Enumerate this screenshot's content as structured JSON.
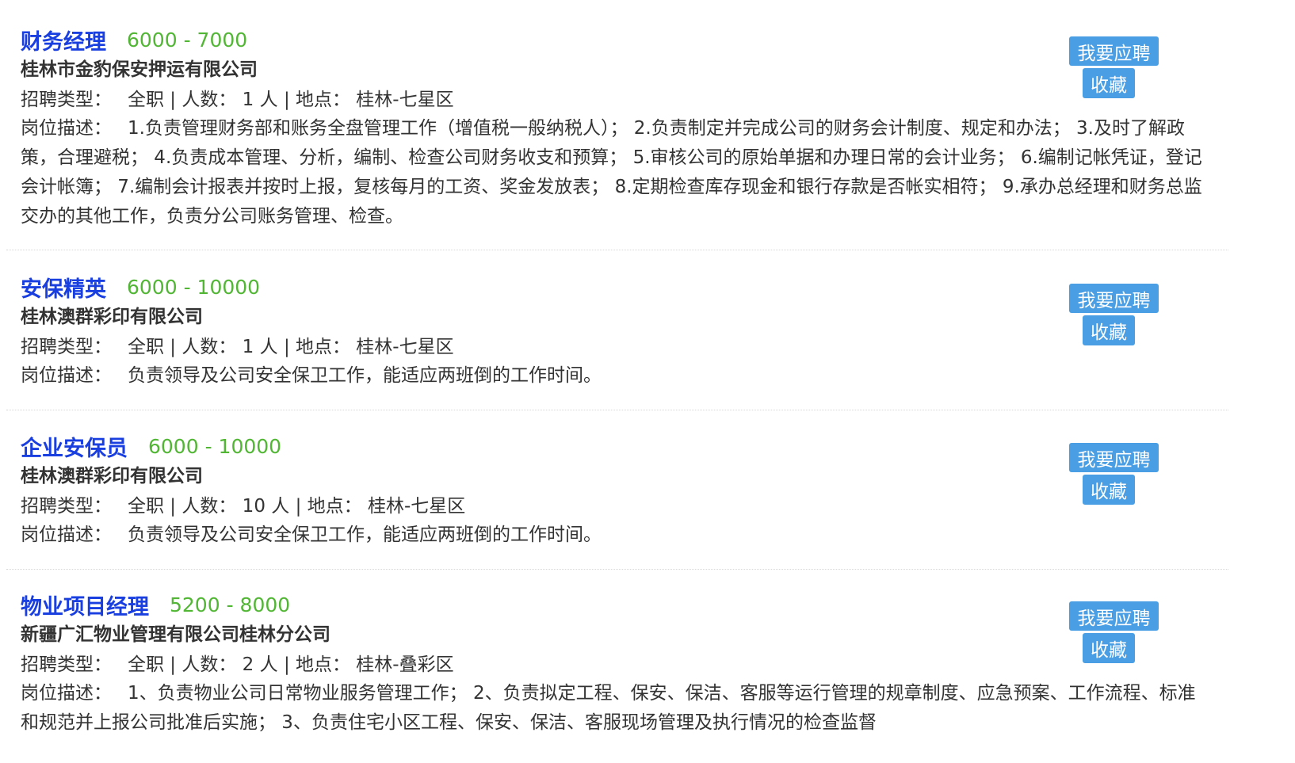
{
  "labels": {
    "type": "招聘类型：",
    "desc": "岗位描述：",
    "apply_button": "我要应聘",
    "favorite_button": "收藏"
  },
  "jobs": [
    {
      "title": "财务经理",
      "salary": "6000 - 7000",
      "company": "桂林市金豹保安押运有限公司",
      "info": "全职 | 人数： 1 人 | 地点： 桂林-七星区",
      "description": "1.负责管理财务部和账务全盘管理工作（增值税一般纳税人）； 2.负责制定并完成公司的财务会计制度、规定和办法； 3.及时了解政策，合理避税； 4.负责成本管理、分析，编制、检查公司财务收支和预算； 5.审核公司的原始单据和办理日常的会计业务； 6.编制记帐凭证，登记会计帐簿； 7.编制会计报表并按时上报，复核每月的工资、奖金发放表； 8.定期检查库存现金和银行存款是否帐实相符； 9.承办总经理和财务总监交办的其他工作，负责分公司账务管理、检查。"
    },
    {
      "title": "安保精英",
      "salary": "6000 - 10000",
      "company": "桂林澳群彩印有限公司",
      "info": "全职 | 人数： 1 人 | 地点： 桂林-七星区",
      "description": "负责领导及公司安全保卫工作，能适应两班倒的工作时间。"
    },
    {
      "title": "企业安保员",
      "salary": "6000 - 10000",
      "company": "桂林澳群彩印有限公司",
      "info": "全职 | 人数： 10 人 | 地点： 桂林-七星区",
      "description": "负责领导及公司安全保卫工作，能适应两班倒的工作时间。"
    },
    {
      "title": "物业项目经理",
      "salary": "5200 - 8000",
      "company": "新疆广汇物业管理有限公司桂林分公司",
      "info": "全职 | 人数： 2 人 | 地点： 桂林-叠彩区",
      "description": "1、负责物业公司日常物业服务管理工作； 2、负责拟定工程、保安、保洁、客服等运行管理的规章制度、应急预案、工作流程、标准和规范并上报公司批准后实施； 3、负责住宅小区工程、保安、保洁、客服现场管理及执行情况的检查监督"
    }
  ]
}
